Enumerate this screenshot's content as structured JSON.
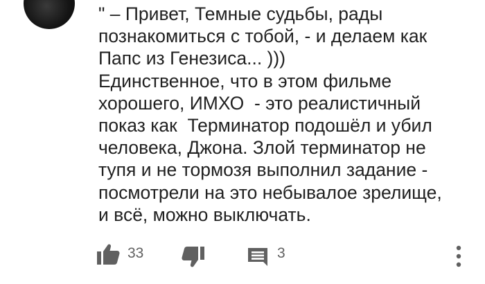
{
  "comment": {
    "text_lines": [
      "\" – Привет, Темные судьбы, рады",
      "познакомиться с тобой, - и делаем как",
      "Папс из Генезиса... )))",
      "Единственное, что в этом фильме",
      "хорошего, ИМХО  - это реалистичный",
      "показ как  Терминатор подошёл и убил",
      "человека, Джона. Злой терминатор не",
      "тупя и не тормозя выполнил задание -",
      "посмотрели на это небывалое зрелище,",
      "и всё, можно выключать."
    ]
  },
  "actions": {
    "like_count": "33",
    "reply_count": "3",
    "icons": {
      "like": "thumbs-up-icon",
      "dislike": "thumbs-down-icon",
      "reply": "comment-icon",
      "more": "more-vertical-icon"
    },
    "icon_color": "#606060"
  }
}
